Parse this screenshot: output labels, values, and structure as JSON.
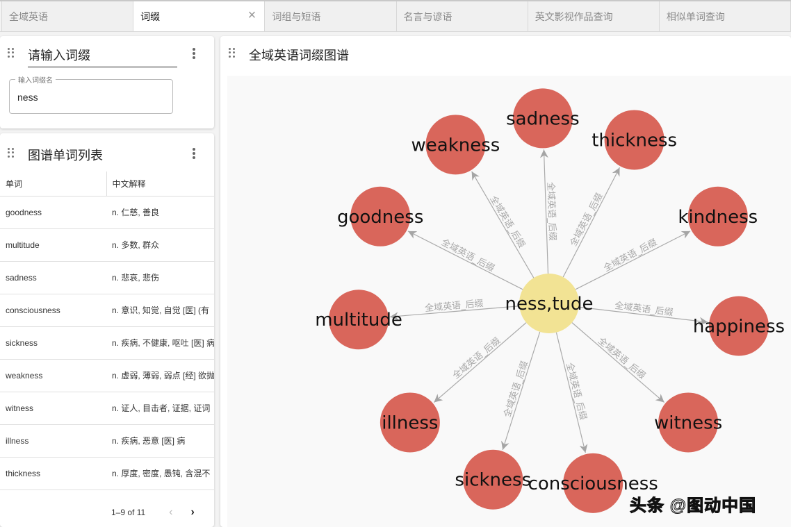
{
  "tabs": [
    {
      "label": "全域英语",
      "active": false
    },
    {
      "label": "词缀",
      "active": true,
      "close_icon": "close-icon"
    },
    {
      "label": "词组与短语",
      "active": false
    },
    {
      "label": "名言与谚语",
      "active": false
    },
    {
      "label": "英文影视作品查询",
      "active": false
    },
    {
      "label": "相似单词查询",
      "active": false
    }
  ],
  "input_panel": {
    "title": "请输入词缀",
    "field_label": "输入词缀名",
    "field_value": "ness"
  },
  "list_panel": {
    "title": "图谱单词列表",
    "columns": [
      "单词",
      "中文解释"
    ],
    "rows": [
      {
        "word": "goodness",
        "meaning": "n. 仁慈, 善良"
      },
      {
        "word": "multitude",
        "meaning": "n. 多数, 群众"
      },
      {
        "word": "sadness",
        "meaning": "n. 悲哀, 悲伤"
      },
      {
        "word": "consciousness",
        "meaning": "n. 意识, 知觉, 自觉 [医] (有"
      },
      {
        "word": "sickness",
        "meaning": "n. 疾病, 不健康, 呕吐 [医] 病"
      },
      {
        "word": "weakness",
        "meaning": "n. 虚弱, 薄弱, 弱点 [经] 欲抛"
      },
      {
        "word": "witness",
        "meaning": "n. 证人, 目击者, 证据, 证词"
      },
      {
        "word": "illness",
        "meaning": "n. 疾病, 恶意 [医] 病"
      },
      {
        "word": "thickness",
        "meaning": "n. 厚度, 密度, 愚钝, 含混不"
      }
    ],
    "pagination": "1–9 of 11",
    "prev_icon": "‹",
    "next_icon": "›"
  },
  "graph_panel": {
    "title": "全域英语词缀图谱",
    "center": {
      "label": "ness,tude",
      "color": "#f2e394"
    },
    "node_color": "#d9665b",
    "edge_label": "全域英语_后缀",
    "nodes": [
      {
        "label": "sadness",
        "angle": -92
      },
      {
        "label": "thickness",
        "angle": -62
      },
      {
        "label": "kindness",
        "angle": -28
      },
      {
        "label": "happiness",
        "angle": 7
      },
      {
        "label": "witness",
        "angle": 40
      },
      {
        "label": "consciousness",
        "angle": 76
      },
      {
        "label": "sickness",
        "angle": 108
      },
      {
        "label": "illness",
        "angle": 140
      },
      {
        "label": "multitude",
        "angle": 175
      },
      {
        "label": "goodness",
        "angle": -152
      },
      {
        "label": "weakness",
        "angle": -121
      }
    ]
  },
  "watermark": "头条 @图动中国"
}
